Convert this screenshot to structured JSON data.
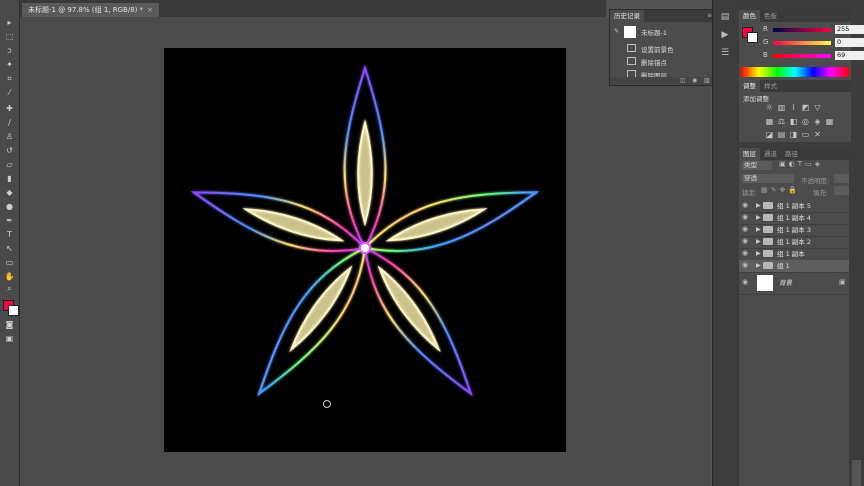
{
  "document": {
    "tab_title": "未标题-1 @ 97.8% (组 1, RGB/8) *",
    "close": "×"
  },
  "history": {
    "tab": "历史记录",
    "snapshot_name": "未标题-1",
    "steps": [
      "设置前景色",
      "删除锚点",
      "删除图层"
    ]
  },
  "color": {
    "tabs": [
      "颜色",
      "色板"
    ],
    "channels": [
      {
        "label": "R",
        "value": "255"
      },
      {
        "label": "G",
        "value": "0"
      },
      {
        "label": "B",
        "value": "69"
      }
    ],
    "foreground": "#ff0045"
  },
  "adjustments": {
    "tabs": [
      "调整",
      "样式"
    ],
    "heading": "添加调整"
  },
  "layers": {
    "tabs": [
      "图层",
      "通道",
      "路径"
    ],
    "kind_filter": "类型",
    "blend_mode": "穿透",
    "opacity_label": "不透明度:",
    "lock_label": "锁定:",
    "fill_label": "填充:",
    "items": [
      {
        "name": "组 1 副本 5"
      },
      {
        "name": "组 1 副本 4"
      },
      {
        "name": "组 1 副本 3"
      },
      {
        "name": "组 1 副本 2"
      },
      {
        "name": "组 1 副本"
      },
      {
        "name": "组 1"
      }
    ],
    "background": "背景"
  },
  "icons": {
    "toolbar": [
      "move-icon",
      "marquee-icon",
      "lasso-icon",
      "magic-wand-icon",
      "crop-icon",
      "eyedropper-icon",
      "healing-brush-icon",
      "brush-icon",
      "clone-stamp-icon",
      "history-brush-icon",
      "eraser-icon",
      "gradient-icon",
      "blur-icon",
      "dodge-icon",
      "pen-icon",
      "type-icon",
      "path-selection-icon",
      "shape-icon",
      "hand-icon",
      "zoom-icon"
    ]
  }
}
